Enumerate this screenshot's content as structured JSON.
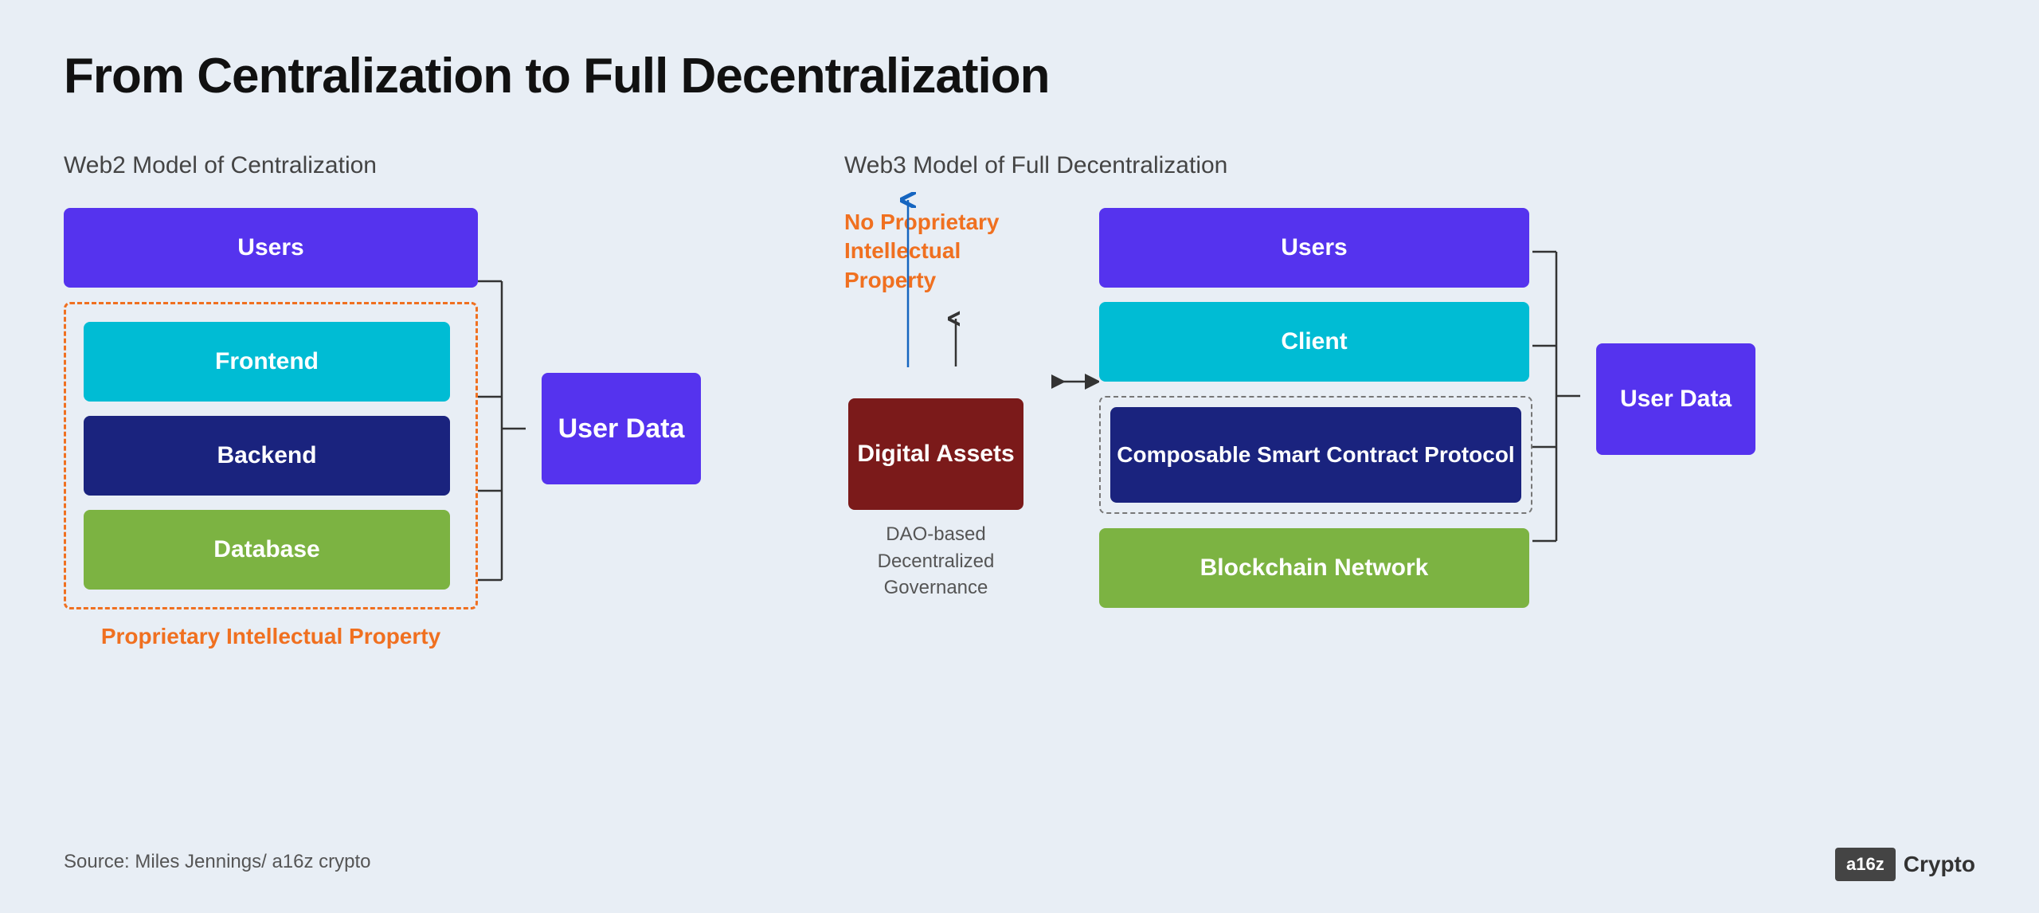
{
  "page": {
    "background": "#e8eef5",
    "title": "From Centralization to Full Decentralization"
  },
  "web2": {
    "section_title": "Web2 Model of Centralization",
    "blocks": {
      "users": "Users",
      "frontend": "Frontend",
      "backend": "Backend",
      "database": "Database",
      "user_data": "User Data"
    },
    "prop_label": "Proprietary Intellectual Property"
  },
  "web3": {
    "section_title": "Web3 Model of Full Decentralization",
    "blocks": {
      "users": "Users",
      "client": "Client",
      "digital_assets": "Digital Assets",
      "composable": "Composable Smart Contract Protocol",
      "blockchain": "Blockchain Network",
      "user_data": "User Data"
    },
    "no_prop_label": "No Proprietary Intellectual Property",
    "dao_label": "DAO-based Decentralized Governance"
  },
  "source": "Source:  Miles Jennings/ a16z crypto",
  "logo": {
    "box": "a16z",
    "text": "Crypto"
  }
}
